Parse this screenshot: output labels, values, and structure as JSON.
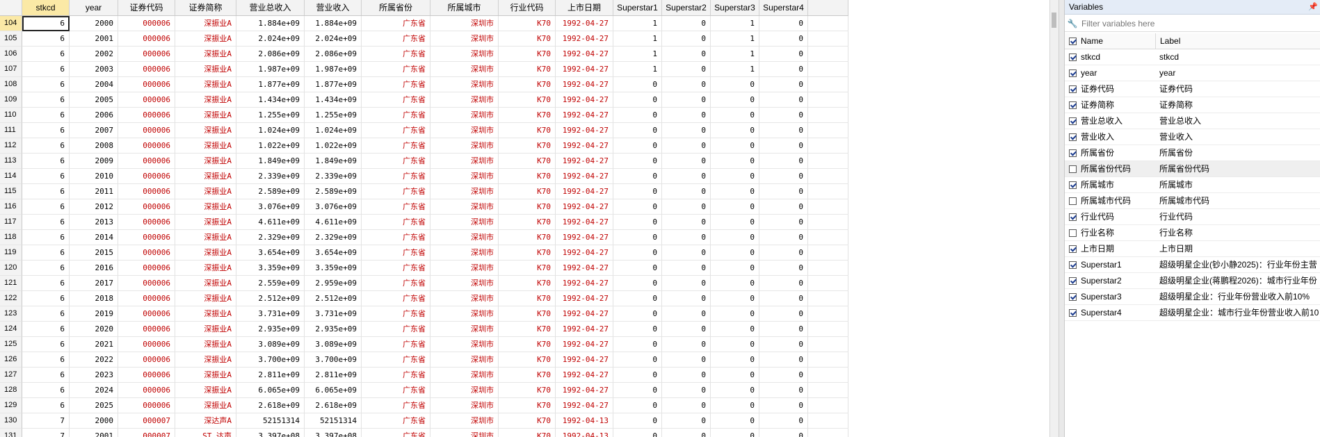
{
  "grid": {
    "columns": [
      "stkcd",
      "year",
      "证券代码",
      "证券简称",
      "营业总收入",
      "营业收入",
      "所属省份",
      "所属城市",
      "行业代码",
      "上市日期",
      "Superstar1",
      "Superstar2",
      "Superstar3",
      "Superstar4"
    ],
    "selected_column": "stkcd",
    "rows": [
      {
        "n": "104",
        "v": [
          "6",
          "2000",
          "000006",
          "深振业A",
          "1.884e+09",
          "1.884e+09",
          "广东省",
          "深圳市",
          "K70",
          "1992-04-27",
          "1",
          "0",
          "1",
          "0"
        ]
      },
      {
        "n": "105",
        "v": [
          "6",
          "2001",
          "000006",
          "深振业A",
          "2.024e+09",
          "2.024e+09",
          "广东省",
          "深圳市",
          "K70",
          "1992-04-27",
          "1",
          "0",
          "1",
          "0"
        ]
      },
      {
        "n": "106",
        "v": [
          "6",
          "2002",
          "000006",
          "深振业A",
          "2.086e+09",
          "2.086e+09",
          "广东省",
          "深圳市",
          "K70",
          "1992-04-27",
          "1",
          "0",
          "1",
          "0"
        ]
      },
      {
        "n": "107",
        "v": [
          "6",
          "2003",
          "000006",
          "深振业A",
          "1.987e+09",
          "1.987e+09",
          "广东省",
          "深圳市",
          "K70",
          "1992-04-27",
          "1",
          "0",
          "1",
          "0"
        ]
      },
      {
        "n": "108",
        "v": [
          "6",
          "2004",
          "000006",
          "深振业A",
          "1.877e+09",
          "1.877e+09",
          "广东省",
          "深圳市",
          "K70",
          "1992-04-27",
          "0",
          "0",
          "0",
          "0"
        ]
      },
      {
        "n": "109",
        "v": [
          "6",
          "2005",
          "000006",
          "深振业A",
          "1.434e+09",
          "1.434e+09",
          "广东省",
          "深圳市",
          "K70",
          "1992-04-27",
          "0",
          "0",
          "0",
          "0"
        ]
      },
      {
        "n": "110",
        "v": [
          "6",
          "2006",
          "000006",
          "深振业A",
          "1.255e+09",
          "1.255e+09",
          "广东省",
          "深圳市",
          "K70",
          "1992-04-27",
          "0",
          "0",
          "0",
          "0"
        ]
      },
      {
        "n": "111",
        "v": [
          "6",
          "2007",
          "000006",
          "深振业A",
          "1.024e+09",
          "1.024e+09",
          "广东省",
          "深圳市",
          "K70",
          "1992-04-27",
          "0",
          "0",
          "0",
          "0"
        ]
      },
      {
        "n": "112",
        "v": [
          "6",
          "2008",
          "000006",
          "深振业A",
          "1.022e+09",
          "1.022e+09",
          "广东省",
          "深圳市",
          "K70",
          "1992-04-27",
          "0",
          "0",
          "0",
          "0"
        ]
      },
      {
        "n": "113",
        "v": [
          "6",
          "2009",
          "000006",
          "深振业A",
          "1.849e+09",
          "1.849e+09",
          "广东省",
          "深圳市",
          "K70",
          "1992-04-27",
          "0",
          "0",
          "0",
          "0"
        ]
      },
      {
        "n": "114",
        "v": [
          "6",
          "2010",
          "000006",
          "深振业A",
          "2.339e+09",
          "2.339e+09",
          "广东省",
          "深圳市",
          "K70",
          "1992-04-27",
          "0",
          "0",
          "0",
          "0"
        ]
      },
      {
        "n": "115",
        "v": [
          "6",
          "2011",
          "000006",
          "深振业A",
          "2.589e+09",
          "2.589e+09",
          "广东省",
          "深圳市",
          "K70",
          "1992-04-27",
          "0",
          "0",
          "0",
          "0"
        ]
      },
      {
        "n": "116",
        "v": [
          "6",
          "2012",
          "000006",
          "深振业A",
          "3.076e+09",
          "3.076e+09",
          "广东省",
          "深圳市",
          "K70",
          "1992-04-27",
          "0",
          "0",
          "0",
          "0"
        ]
      },
      {
        "n": "117",
        "v": [
          "6",
          "2013",
          "000006",
          "深振业A",
          "4.611e+09",
          "4.611e+09",
          "广东省",
          "深圳市",
          "K70",
          "1992-04-27",
          "0",
          "0",
          "0",
          "0"
        ]
      },
      {
        "n": "118",
        "v": [
          "6",
          "2014",
          "000006",
          "深振业A",
          "2.329e+09",
          "2.329e+09",
          "广东省",
          "深圳市",
          "K70",
          "1992-04-27",
          "0",
          "0",
          "0",
          "0"
        ]
      },
      {
        "n": "119",
        "v": [
          "6",
          "2015",
          "000006",
          "深振业A",
          "3.654e+09",
          "3.654e+09",
          "广东省",
          "深圳市",
          "K70",
          "1992-04-27",
          "0",
          "0",
          "0",
          "0"
        ]
      },
      {
        "n": "120",
        "v": [
          "6",
          "2016",
          "000006",
          "深振业A",
          "3.359e+09",
          "3.359e+09",
          "广东省",
          "深圳市",
          "K70",
          "1992-04-27",
          "0",
          "0",
          "0",
          "0"
        ]
      },
      {
        "n": "121",
        "v": [
          "6",
          "2017",
          "000006",
          "深振业A",
          "2.559e+09",
          "2.959e+09",
          "广东省",
          "深圳市",
          "K70",
          "1992-04-27",
          "0",
          "0",
          "0",
          "0"
        ]
      },
      {
        "n": "122",
        "v": [
          "6",
          "2018",
          "000006",
          "深振业A",
          "2.512e+09",
          "2.512e+09",
          "广东省",
          "深圳市",
          "K70",
          "1992-04-27",
          "0",
          "0",
          "0",
          "0"
        ]
      },
      {
        "n": "123",
        "v": [
          "6",
          "2019",
          "000006",
          "深振业A",
          "3.731e+09",
          "3.731e+09",
          "广东省",
          "深圳市",
          "K70",
          "1992-04-27",
          "0",
          "0",
          "0",
          "0"
        ]
      },
      {
        "n": "124",
        "v": [
          "6",
          "2020",
          "000006",
          "深振业A",
          "2.935e+09",
          "2.935e+09",
          "广东省",
          "深圳市",
          "K70",
          "1992-04-27",
          "0",
          "0",
          "0",
          "0"
        ]
      },
      {
        "n": "125",
        "v": [
          "6",
          "2021",
          "000006",
          "深振业A",
          "3.089e+09",
          "3.089e+09",
          "广东省",
          "深圳市",
          "K70",
          "1992-04-27",
          "0",
          "0",
          "0",
          "0"
        ]
      },
      {
        "n": "126",
        "v": [
          "6",
          "2022",
          "000006",
          "深振业A",
          "3.700e+09",
          "3.700e+09",
          "广东省",
          "深圳市",
          "K70",
          "1992-04-27",
          "0",
          "0",
          "0",
          "0"
        ]
      },
      {
        "n": "127",
        "v": [
          "6",
          "2023",
          "000006",
          "深振业A",
          "2.811e+09",
          "2.811e+09",
          "广东省",
          "深圳市",
          "K70",
          "1992-04-27",
          "0",
          "0",
          "0",
          "0"
        ]
      },
      {
        "n": "128",
        "v": [
          "6",
          "2024",
          "000006",
          "深振业A",
          "6.065e+09",
          "6.065e+09",
          "广东省",
          "深圳市",
          "K70",
          "1992-04-27",
          "0",
          "0",
          "0",
          "0"
        ]
      },
      {
        "n": "129",
        "v": [
          "6",
          "2025",
          "000006",
          "深振业A",
          "2.618e+09",
          "2.618e+09",
          "广东省",
          "深圳市",
          "K70",
          "1992-04-27",
          "0",
          "0",
          "0",
          "0"
        ]
      },
      {
        "n": "130",
        "v": [
          "7",
          "2000",
          "000007",
          "深达声A",
          "52151314",
          "52151314",
          "广东省",
          "深圳市",
          "K70",
          "1992-04-13",
          "0",
          "0",
          "0",
          "0"
        ]
      },
      {
        "n": "131",
        "v": [
          "7",
          "2001",
          "000007",
          "ST 达声",
          "3.397e+08",
          "3.397e+08",
          "广东省",
          "深圳市",
          "K70",
          "1992-04-13",
          "0",
          "0",
          "0",
          "0"
        ]
      }
    ]
  },
  "vars_panel": {
    "title": "Variables",
    "pin_icon": "pin-icon",
    "filter_placeholder": "Filter variables here",
    "col_name": "Name",
    "col_label": "Label",
    "items": [
      {
        "name": "stkcd",
        "label": "stkcd",
        "checked": true
      },
      {
        "name": "year",
        "label": "year",
        "checked": true
      },
      {
        "name": "证券代码",
        "label": "证券代码",
        "checked": true
      },
      {
        "name": "证券简称",
        "label": "证券简称",
        "checked": true
      },
      {
        "name": "营业总收入",
        "label": "营业总收入",
        "checked": true
      },
      {
        "name": "营业收入",
        "label": "营业收入",
        "checked": true
      },
      {
        "name": "所属省份",
        "label": "所属省份",
        "checked": true
      },
      {
        "name": "所属省份代码",
        "label": "所属省份代码",
        "checked": false
      },
      {
        "name": "所属城市",
        "label": "所属城市",
        "checked": true
      },
      {
        "name": "所属城市代码",
        "label": "所属城市代码",
        "checked": false
      },
      {
        "name": "行业代码",
        "label": "行业代码",
        "checked": true
      },
      {
        "name": "行业名称",
        "label": "行业名称",
        "checked": false
      },
      {
        "name": "上市日期",
        "label": "上市日期",
        "checked": true
      },
      {
        "name": "Superstar1",
        "label": "超级明星企业(钞小静2025)：行业年份主营",
        "checked": true
      },
      {
        "name": "Superstar2",
        "label": "超级明星企业(蒋鹏程2026)：城市行业年份",
        "checked": true
      },
      {
        "name": "Superstar3",
        "label": "超级明星企业：行业年份营业收入前10%",
        "checked": true
      },
      {
        "name": "Superstar4",
        "label": "超级明星企业：城市行业年份营业收入前10",
        "checked": true
      }
    ],
    "highlighted_item": "所属省份代码"
  }
}
